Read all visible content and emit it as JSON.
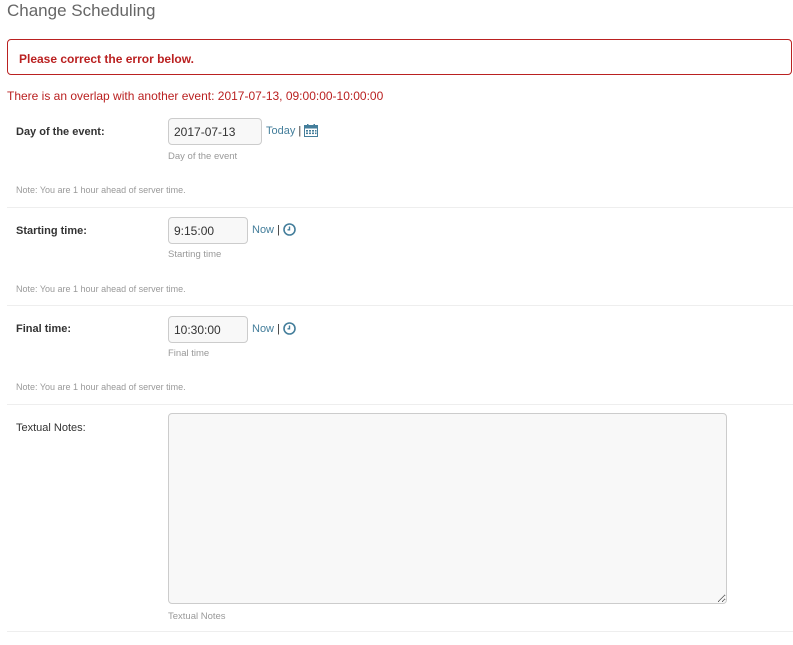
{
  "page": {
    "title": "Change Scheduling"
  },
  "errors": {
    "note": "Please correct the error below.",
    "overlap": "There is an overlap with another event: 2017-07-13, 09:00:00-10:00:00"
  },
  "fields": {
    "day": {
      "label": "Day of the event:",
      "value": "2017-07-13",
      "help": "Day of the event",
      "shortcut_label": "Today",
      "separator": "|",
      "note": "Note: You are 1 hour ahead of server time."
    },
    "start": {
      "label": "Starting time:",
      "value": "9:15:00",
      "help": "Starting time",
      "shortcut_label": "Now",
      "separator": "|",
      "note": "Note: You are 1 hour ahead of server time."
    },
    "end": {
      "label": "Final time:",
      "value": "10:30:00",
      "help": "Final time",
      "shortcut_label": "Now",
      "separator": "|",
      "note": "Note: You are 1 hour ahead of server time."
    },
    "notes": {
      "label": "Textual Notes:",
      "value": "",
      "help": "Textual Notes"
    }
  },
  "icons": {
    "calendar": "calendar-icon",
    "clock": "clock-icon"
  },
  "colors": {
    "error": "#ba2121",
    "link": "#447e9b",
    "muted": "#999999"
  }
}
